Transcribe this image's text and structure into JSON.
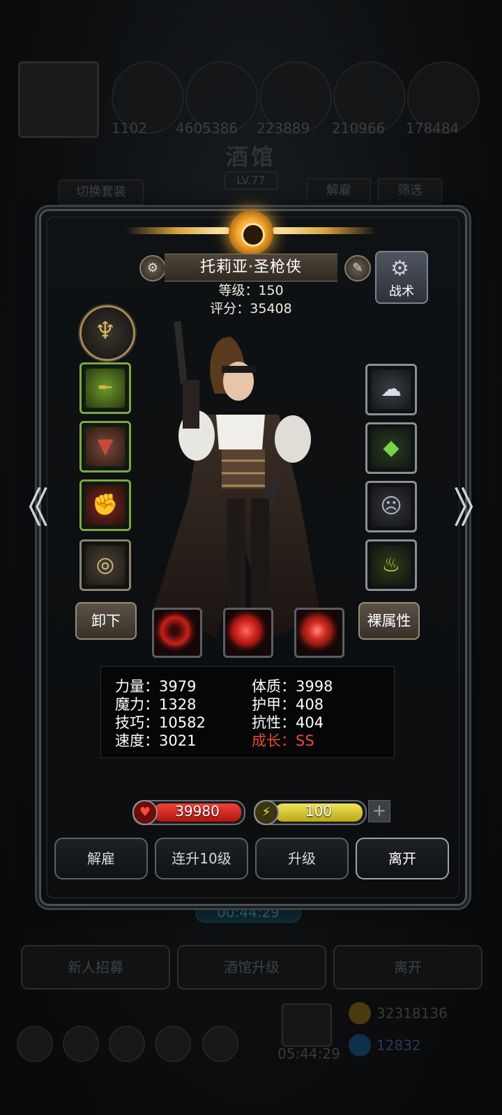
{
  "background": {
    "resources": [
      "1102",
      "4605386",
      "223889",
      "210966",
      "178484"
    ],
    "title": "酒馆",
    "level": "LV.77",
    "switch_outfit_label": "切换套装",
    "dismiss_label": "解雇",
    "filter_label": "筛选",
    "timer": "00:44:29",
    "bottom_buttons": [
      "新人招募",
      "酒馆升级",
      "离开"
    ],
    "gold": "32318136",
    "gems": "12832",
    "countdown": "05:44:29"
  },
  "hero": {
    "name": "托莉亚·圣枪侠",
    "level_label": "等级",
    "level_value": "150",
    "score_label": "评分",
    "score_value": "35408",
    "level_line": "等级：150",
    "score_line": "评分：35408",
    "tactics_label": "战术"
  },
  "equipment": {
    "left_slots": [
      "golden-rifle-icon",
      "red-armor-icon",
      "crimson-gauntlet-icon",
      "ring-icon"
    ],
    "right_slots": [
      "silver-cloud-crown-icon",
      "green-cocoon-icon",
      "mask-icon",
      "lantern-icon"
    ]
  },
  "actions": {
    "unequip_label": "卸下",
    "base_attr_label": "裸属性"
  },
  "stats": {
    "strength": "力量：3979",
    "magic": "魔力：1328",
    "skill": "技巧：10582",
    "speed": "速度：3021",
    "constitution": "体质：3998",
    "armor": "护甲：408",
    "resistance": "抗性：404",
    "growth": "成长：SS"
  },
  "bars": {
    "hp": "39980",
    "energy": "100",
    "energy_fraction": 1.0,
    "hp_fraction": 1.0
  },
  "buttons": {
    "dismiss": "解雇",
    "level_up_10": "连升10级",
    "level_up": "升级",
    "leave": "离开"
  },
  "nav": {
    "prev": "《",
    "next": "》"
  },
  "colors": {
    "hp": "#d0231d",
    "energy": "#d9cc2a",
    "growth": "#e84a35"
  }
}
